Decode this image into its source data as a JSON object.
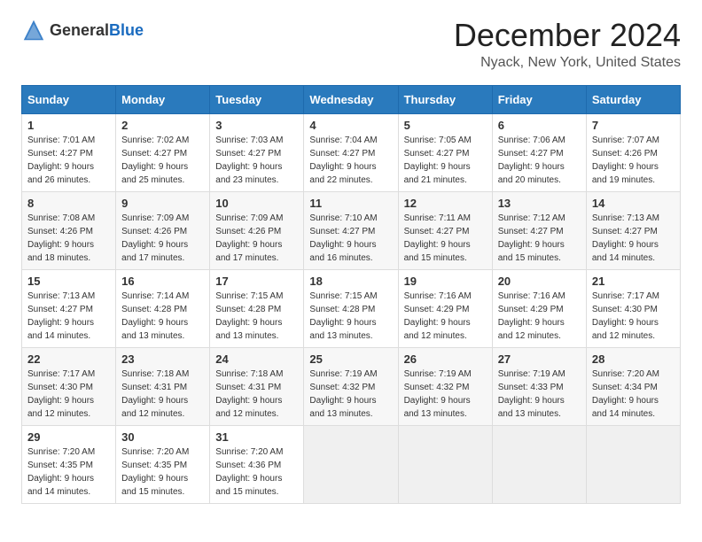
{
  "header": {
    "logo_general": "General",
    "logo_blue": "Blue",
    "title": "December 2024",
    "subtitle": "Nyack, New York, United States"
  },
  "calendar": {
    "days_of_week": [
      "Sunday",
      "Monday",
      "Tuesday",
      "Wednesday",
      "Thursday",
      "Friday",
      "Saturday"
    ],
    "weeks": [
      [
        {
          "day": "1",
          "sunrise": "7:01 AM",
          "sunset": "4:27 PM",
          "daylight": "9 hours and 26 minutes."
        },
        {
          "day": "2",
          "sunrise": "7:02 AM",
          "sunset": "4:27 PM",
          "daylight": "9 hours and 25 minutes."
        },
        {
          "day": "3",
          "sunrise": "7:03 AM",
          "sunset": "4:27 PM",
          "daylight": "9 hours and 23 minutes."
        },
        {
          "day": "4",
          "sunrise": "7:04 AM",
          "sunset": "4:27 PM",
          "daylight": "9 hours and 22 minutes."
        },
        {
          "day": "5",
          "sunrise": "7:05 AM",
          "sunset": "4:27 PM",
          "daylight": "9 hours and 21 minutes."
        },
        {
          "day": "6",
          "sunrise": "7:06 AM",
          "sunset": "4:27 PM",
          "daylight": "9 hours and 20 minutes."
        },
        {
          "day": "7",
          "sunrise": "7:07 AM",
          "sunset": "4:26 PM",
          "daylight": "9 hours and 19 minutes."
        }
      ],
      [
        {
          "day": "8",
          "sunrise": "7:08 AM",
          "sunset": "4:26 PM",
          "daylight": "9 hours and 18 minutes."
        },
        {
          "day": "9",
          "sunrise": "7:09 AM",
          "sunset": "4:26 PM",
          "daylight": "9 hours and 17 minutes."
        },
        {
          "day": "10",
          "sunrise": "7:09 AM",
          "sunset": "4:26 PM",
          "daylight": "9 hours and 17 minutes."
        },
        {
          "day": "11",
          "sunrise": "7:10 AM",
          "sunset": "4:27 PM",
          "daylight": "9 hours and 16 minutes."
        },
        {
          "day": "12",
          "sunrise": "7:11 AM",
          "sunset": "4:27 PM",
          "daylight": "9 hours and 15 minutes."
        },
        {
          "day": "13",
          "sunrise": "7:12 AM",
          "sunset": "4:27 PM",
          "daylight": "9 hours and 15 minutes."
        },
        {
          "day": "14",
          "sunrise": "7:13 AM",
          "sunset": "4:27 PM",
          "daylight": "9 hours and 14 minutes."
        }
      ],
      [
        {
          "day": "15",
          "sunrise": "7:13 AM",
          "sunset": "4:27 PM",
          "daylight": "9 hours and 14 minutes."
        },
        {
          "day": "16",
          "sunrise": "7:14 AM",
          "sunset": "4:28 PM",
          "daylight": "9 hours and 13 minutes."
        },
        {
          "day": "17",
          "sunrise": "7:15 AM",
          "sunset": "4:28 PM",
          "daylight": "9 hours and 13 minutes."
        },
        {
          "day": "18",
          "sunrise": "7:15 AM",
          "sunset": "4:28 PM",
          "daylight": "9 hours and 13 minutes."
        },
        {
          "day": "19",
          "sunrise": "7:16 AM",
          "sunset": "4:29 PM",
          "daylight": "9 hours and 12 minutes."
        },
        {
          "day": "20",
          "sunrise": "7:16 AM",
          "sunset": "4:29 PM",
          "daylight": "9 hours and 12 minutes."
        },
        {
          "day": "21",
          "sunrise": "7:17 AM",
          "sunset": "4:30 PM",
          "daylight": "9 hours and 12 minutes."
        }
      ],
      [
        {
          "day": "22",
          "sunrise": "7:17 AM",
          "sunset": "4:30 PM",
          "daylight": "9 hours and 12 minutes."
        },
        {
          "day": "23",
          "sunrise": "7:18 AM",
          "sunset": "4:31 PM",
          "daylight": "9 hours and 12 minutes."
        },
        {
          "day": "24",
          "sunrise": "7:18 AM",
          "sunset": "4:31 PM",
          "daylight": "9 hours and 12 minutes."
        },
        {
          "day": "25",
          "sunrise": "7:19 AM",
          "sunset": "4:32 PM",
          "daylight": "9 hours and 13 minutes."
        },
        {
          "day": "26",
          "sunrise": "7:19 AM",
          "sunset": "4:32 PM",
          "daylight": "9 hours and 13 minutes."
        },
        {
          "day": "27",
          "sunrise": "7:19 AM",
          "sunset": "4:33 PM",
          "daylight": "9 hours and 13 minutes."
        },
        {
          "day": "28",
          "sunrise": "7:20 AM",
          "sunset": "4:34 PM",
          "daylight": "9 hours and 14 minutes."
        }
      ],
      [
        {
          "day": "29",
          "sunrise": "7:20 AM",
          "sunset": "4:35 PM",
          "daylight": "9 hours and 14 minutes."
        },
        {
          "day": "30",
          "sunrise": "7:20 AM",
          "sunset": "4:35 PM",
          "daylight": "9 hours and 15 minutes."
        },
        {
          "day": "31",
          "sunrise": "7:20 AM",
          "sunset": "4:36 PM",
          "daylight": "9 hours and 15 minutes."
        },
        null,
        null,
        null,
        null
      ]
    ]
  }
}
